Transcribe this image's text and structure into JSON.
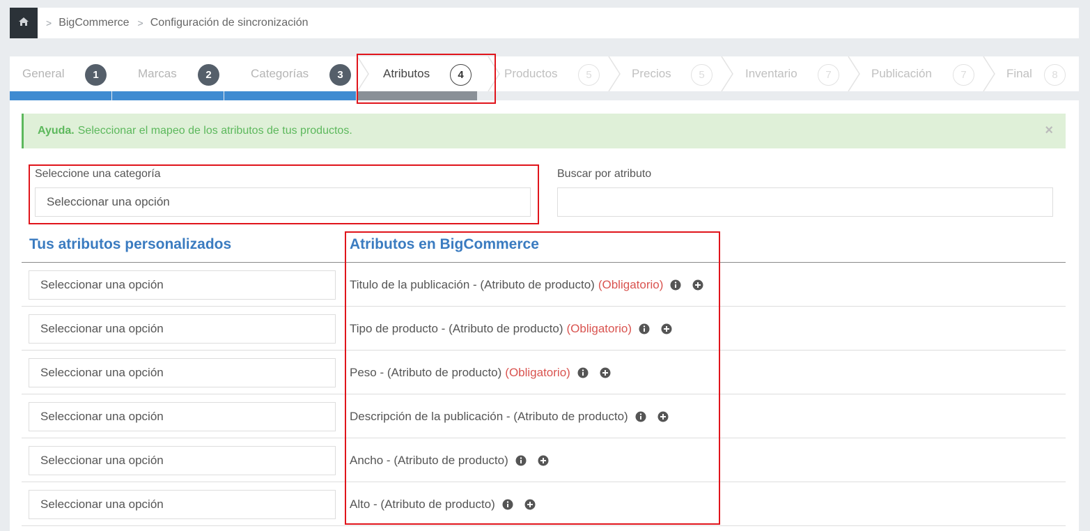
{
  "breadcrumb": {
    "home_icon": "home-icon",
    "items": [
      "BigCommerce",
      "Configuración de sincronización"
    ]
  },
  "wizard": {
    "steps": [
      {
        "label": "General",
        "number": "1",
        "state": "done"
      },
      {
        "label": "Marcas",
        "number": "2",
        "state": "done"
      },
      {
        "label": "Categorías",
        "number": "3",
        "state": "done"
      },
      {
        "label": "Atributos",
        "number": "4",
        "state": "active"
      },
      {
        "label": "Productos",
        "number": "5",
        "state": "todo"
      },
      {
        "label": "Precios",
        "number": "5",
        "state": "todo"
      },
      {
        "label": "Inventario",
        "number": "7",
        "state": "todo"
      },
      {
        "label": "Publicación",
        "number": "7",
        "state": "todo"
      },
      {
        "label": "Final",
        "number": "8",
        "state": "todo"
      }
    ]
  },
  "help": {
    "strong": "Ayuda.",
    "text": "Seleccionar el mapeo de los atributos de tus productos.",
    "close": "×"
  },
  "filters": {
    "category_label": "Seleccione una categoría",
    "category_value": "Seleccionar una opción",
    "search_label": "Buscar por atributo",
    "search_value": ""
  },
  "columns": {
    "custom_title": "Tus atributos personalizados",
    "bigcommerce_title": "Atributos en BigCommerce"
  },
  "rows": [
    {
      "select": "Seleccionar una opción",
      "name": "Titulo de la publicación",
      "dash": " - ",
      "type": "(Atributo de producto)",
      "required": "(Obligatorio)"
    },
    {
      "select": "Seleccionar una opción",
      "name": "Tipo de producto",
      "dash": " - ",
      "type": "(Atributo de producto)",
      "required": "(Obligatorio)"
    },
    {
      "select": "Seleccionar una opción",
      "name": "Peso",
      "dash": " - ",
      "type": "(Atributo de producto)",
      "required": "(Obligatorio)"
    },
    {
      "select": "Seleccionar una opción",
      "name": "Descripción de la publicación",
      "dash": " - ",
      "type": "(Atributo de producto)",
      "required": ""
    },
    {
      "select": "Seleccionar una opción",
      "name": "Ancho",
      "dash": " - ",
      "type": "(Atributo de producto)",
      "required": ""
    },
    {
      "select": "Seleccionar una opción",
      "name": "Alto",
      "dash": " - ",
      "type": "(Atributo de producto)",
      "required": ""
    }
  ],
  "colors": {
    "accent_blue": "#3a7bc0",
    "required_red": "#d9534f",
    "success_green": "#5cb85c",
    "highlight_red": "#e0141b"
  }
}
